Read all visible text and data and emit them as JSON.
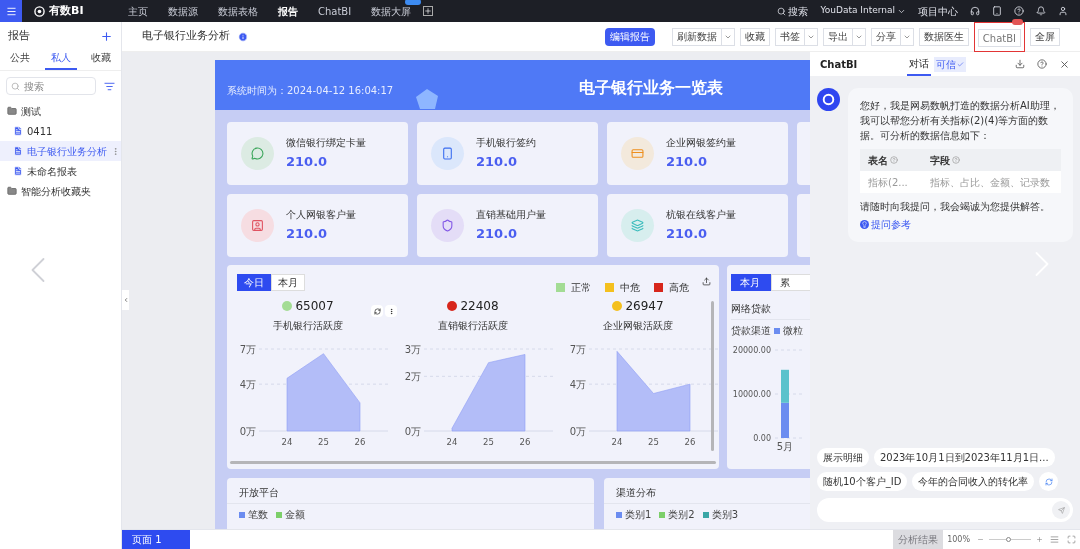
{
  "topbar": {
    "logo": "有数BI",
    "nav": [
      {
        "label": "主页",
        "selected": false,
        "badge": false
      },
      {
        "label": "数据源",
        "selected": false,
        "badge": false
      },
      {
        "label": "数据表格",
        "selected": false,
        "badge": false
      },
      {
        "label": "报告",
        "selected": true,
        "badge": false
      },
      {
        "label": "ChatBI",
        "selected": false,
        "badge": false
      },
      {
        "label": "数据大屏",
        "selected": false,
        "badge": true
      }
    ],
    "search": "搜索",
    "workspace": "YouData Internal",
    "project": "项目中心"
  },
  "sidebar": {
    "title": "报告",
    "tabs": [
      {
        "label": "公共",
        "selected": false
      },
      {
        "label": "私人",
        "selected": true
      },
      {
        "label": "收藏",
        "selected": false
      }
    ],
    "search": {
      "placeholder": "搜索"
    },
    "tree": [
      {
        "label": "测试",
        "kind": "folder",
        "selected": false,
        "children": [
          {
            "label": "0411",
            "kind": "report",
            "selected": false
          },
          {
            "label": "电子银行业务分析",
            "kind": "report",
            "selected": true
          },
          {
            "label": "未命名报表",
            "kind": "report",
            "selected": false
          }
        ]
      },
      {
        "label": "智能分析收藏夹",
        "kind": "folder",
        "selected": false
      }
    ]
  },
  "header": {
    "title": "电子银行业务分析",
    "buttons": [
      {
        "label": "编辑报告",
        "kind": "primary"
      },
      {
        "label": "刷新数据",
        "kind": "dropdown"
      },
      {
        "label": "收藏",
        "kind": "plain"
      },
      {
        "label": "书签",
        "kind": "dropdown"
      },
      {
        "label": "导出",
        "kind": "dropdown"
      },
      {
        "label": "分享",
        "kind": "dropdown"
      },
      {
        "label": "数据医生",
        "kind": "plain"
      },
      {
        "label": "ChatBI",
        "kind": "highlighted"
      },
      {
        "label": "全屏",
        "kind": "plain"
      }
    ]
  },
  "dashboard": {
    "time": "系统时间为：2024-04-12 16:04:17",
    "title": "电子银行业务一览表",
    "kpis": [
      {
        "label": "微信银行绑定卡量",
        "value": "210.0",
        "kind": "wechat"
      },
      {
        "label": "手机银行签约",
        "value": "210.0",
        "kind": "phone"
      },
      {
        "label": "企业网银签约量",
        "value": "210.0",
        "kind": "card"
      },
      {
        "label": "个人网银客户量",
        "value": "210.0",
        "kind": "person"
      },
      {
        "label": "直销基础用户量",
        "value": "210.0",
        "kind": "shield"
      },
      {
        "label": "杭银在线客户量",
        "value": "210.0",
        "kind": "layers"
      }
    ],
    "activity": {
      "tabs": [
        {
          "label": "今日",
          "selected": true
        },
        {
          "label": "本月",
          "selected": false
        }
      ],
      "legend": [
        {
          "label": "正常",
          "color": "#a3dc94"
        },
        {
          "label": "中危",
          "color": "#f4c01e"
        },
        {
          "label": "高危",
          "color": "#d7261b"
        }
      ],
      "charts": [
        {
          "value": "65007",
          "label": "手机银行活跃度",
          "color": "#a3dc94",
          "chart_data": {
            "type": "area",
            "categories": [
              "24",
              "25",
              "26"
            ],
            "values": [
              4.5,
              6.6,
              2.4
            ],
            "ylim": [
              0,
              7
            ],
            "yticks": [
              {
                "value": 0,
                "label": "0万"
              },
              {
                "value": 4,
                "label": "4万"
              },
              {
                "value": 7,
                "label": "7万"
              }
            ]
          }
        },
        {
          "value": "22408",
          "label": "直销银行活跃度",
          "color": "#d7261b",
          "chart_data": {
            "type": "area",
            "categories": [
              "24",
              "25",
              "26"
            ],
            "values": [
              0.1,
              2.5,
              2.8
            ],
            "ylim": [
              0,
              3
            ],
            "yticks": [
              {
                "value": 0,
                "label": "0万"
              },
              {
                "value": 2,
                "label": "2万"
              },
              {
                "value": 3,
                "label": "3万"
              }
            ]
          }
        },
        {
          "value": "26947",
          "label": "企业网银活跃度",
          "color": "#f4c01e",
          "chart_data": {
            "type": "area",
            "categories": [
              "24",
              "25",
              "26"
            ],
            "values": [
              6.8,
              3.2,
              4
            ],
            "ylim": [
              0,
              7
            ],
            "yticks": [
              {
                "value": 0,
                "label": "0万"
              },
              {
                "value": 4,
                "label": "4万"
              },
              {
                "value": 7,
                "label": "7万"
              }
            ]
          }
        }
      ]
    },
    "loans": {
      "tabs": [
        {
          "label": "本月",
          "selected": true
        },
        {
          "label": "累",
          "selected": false
        }
      ],
      "title": "网络贷款",
      "legend_title": "贷款渠道",
      "chart_data": {
        "type": "bar",
        "stacked": true,
        "categories": [
          "5月"
        ],
        "series": [
          {
            "name": "微粒",
            "color": "#6b8cf0",
            "values": [
              8000
            ]
          },
          {
            "color": "#5bc2cc",
            "values": [
              7500
            ]
          }
        ],
        "ylim": [
          0,
          20000
        ],
        "yticks": [
          {
            "value": 0,
            "label": "0.00"
          },
          {
            "value": 10000,
            "label": "10000.00"
          },
          {
            "value": 20000,
            "label": "20000.00"
          }
        ]
      }
    },
    "panels": [
      {
        "title": "开放平台",
        "legend": [
          {
            "label": "笔数",
            "color": "#6b8cf0"
          },
          {
            "label": "金额",
            "color": "#7ccf6a"
          }
        ]
      },
      {
        "title": "渠道分布",
        "legend": [
          {
            "label": "类别1",
            "color": "#6b8cf0"
          },
          {
            "label": "类别2",
            "color": "#7ccf6a"
          },
          {
            "label": "类别3",
            "color": "#3aa6a6"
          }
        ]
      }
    ]
  },
  "chat": {
    "title": "ChatBI",
    "tab": "对话",
    "tab_badge": "可信",
    "message": {
      "text": "您好，我是网易数帆打造的数据分析AI助理，我可以帮您分析有关指标(2)(4)等方面的数据。可分析的数据信息如下：",
      "table": {
        "columns": [
          "表名",
          "字段"
        ],
        "rows": [
          [
            "指标(2...",
            "指标、占比、金额、记录数"
          ]
        ]
      },
      "closing": "请随时向我提问，我会竭诚为您提供解答。",
      "link": "提问参考"
    },
    "suggestions": [
      "展示明细",
      "2023年10月1日到2023年11月1日...",
      "随机10个客户_ID",
      "今年的合同收入的转化率"
    ]
  },
  "footer": {
    "page_tab": "页面 1",
    "analysis": "分析结果",
    "zoom": "100%",
    "zoom_level": {
      "level": 0.45
    }
  }
}
